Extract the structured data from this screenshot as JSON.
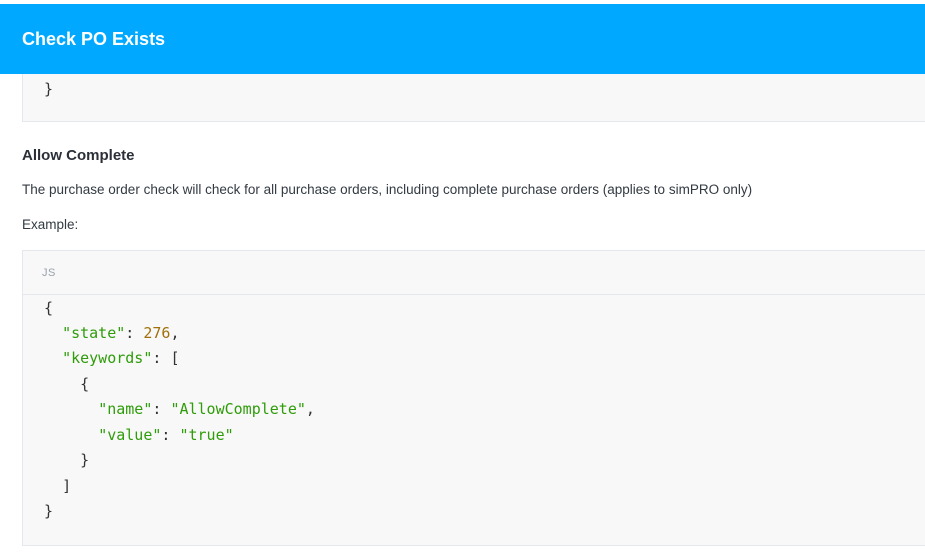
{
  "header": {
    "title": "Check PO Exists"
  },
  "previous_code": {
    "closing_line": "}"
  },
  "section": {
    "title": "Allow Complete",
    "description": "The purchase order check will check for all purchase orders, including complete purchase orders (applies to simPRO only)",
    "example_label": "Example:"
  },
  "code_block": {
    "language": "JS",
    "tokens": {
      "open_brace": "{",
      "state_key": "\"state\"",
      "colon": ": ",
      "state_value": "276",
      "comma": ",",
      "keywords_key": "\"keywords\"",
      "open_bracket": "[",
      "inner_open_brace": "{",
      "name_key": "\"name\"",
      "name_value": "\"AllowComplete\"",
      "value_key": "\"value\"",
      "value_value": "\"true\"",
      "inner_close_brace": "}",
      "close_bracket": "]",
      "close_brace": "}"
    }
  },
  "colors": {
    "header_bg": "#00a9ff",
    "string": "#2f9c0a",
    "number": "#a0700a",
    "code_bg": "#f8f8f8"
  }
}
